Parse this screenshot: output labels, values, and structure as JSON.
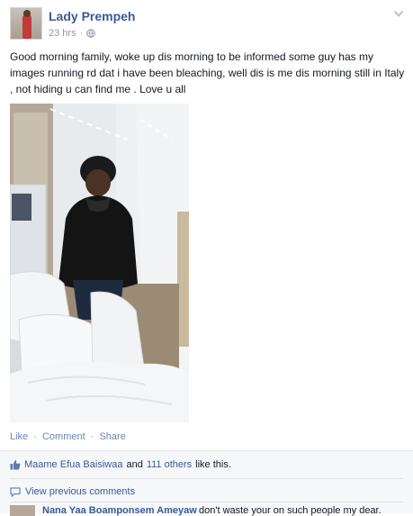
{
  "post": {
    "author": "Lady Prempeh",
    "timestamp": "23 hrs",
    "separator": "·",
    "text": "Good morning family, woke up dis morning to be informed some guy has my images running rd dat i have been bleaching, well dis is me dis morning still in Italy , not hiding u can find me . Love u all"
  },
  "actions": {
    "like": "Like",
    "comment": "Comment",
    "share": "Share",
    "sep": "·"
  },
  "likes": {
    "person": "Maame Efua Baisiwaa",
    "and": "and",
    "others": "111 others",
    "suffix": "like this."
  },
  "comments": {
    "view_previous": "View previous comments",
    "items": [
      {
        "author": "Nana Yaa Boamponsem Ameyaw",
        "text": "don't waste your on such people my dear."
      }
    ]
  },
  "icons": {
    "privacy": "globe-icon",
    "menu": "chevron-down-icon",
    "like": "thumbs-up-icon",
    "comments": "comment-bubble-icon"
  },
  "colors": {
    "link": "#3b5998",
    "meta": "#9197a3",
    "ufi_bg": "#f6f7f9"
  }
}
